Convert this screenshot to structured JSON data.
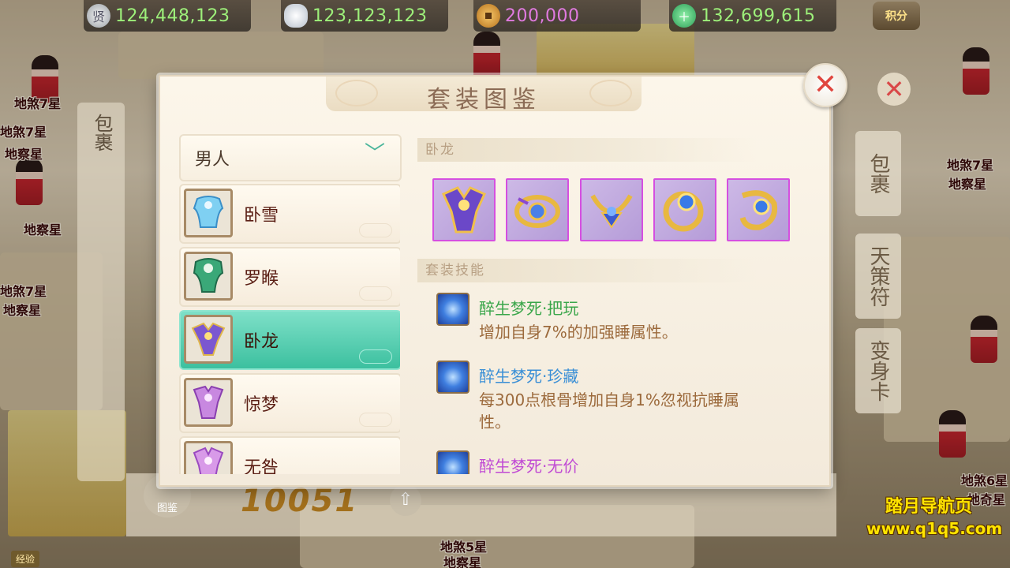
{
  "currency": [
    {
      "icon": "silver-coin-icon",
      "value": "124,448,123"
    },
    {
      "icon": "silver-ingot-icon",
      "value": "123,123,123"
    },
    {
      "icon": "copper-coin-icon",
      "value": "200,000"
    },
    {
      "icon": "jade-icon",
      "value": "132,699,615"
    }
  ],
  "points_button": "积分",
  "background": {
    "npc_names": [
      "地煞7星",
      "地察星",
      "地煞7星",
      "地察星",
      "地煞7星",
      "地察星",
      "地煞7星",
      "地察星",
      "地煞6星",
      "地奇星",
      "地煞5星",
      "地察星"
    ],
    "left_tab": "包裹",
    "right_tabs": [
      "包裹",
      "天策符",
      "变身卡"
    ],
    "score": "10051",
    "tujian_label": "图鉴",
    "exp_label": "经验"
  },
  "dialog": {
    "title": "套装图鉴",
    "gender_selected": "男人",
    "sets": [
      {
        "name": "卧雪",
        "active": false
      },
      {
        "name": "罗睺",
        "active": false
      },
      {
        "name": "卧龙",
        "active": true
      },
      {
        "name": "惊梦",
        "active": false
      },
      {
        "name": "无咎",
        "active": false
      }
    ],
    "current_set_header": "卧龙",
    "skills_header": "套装技能",
    "skills": [
      {
        "title": "醉生梦死·把玩",
        "desc": "增加自身7%的加强睡属性。",
        "color": "#3aa64a"
      },
      {
        "title": "醉生梦死·珍藏",
        "desc": "每300点根骨增加自身1%忽视抗睡属性。",
        "color": "#3a8fd6"
      },
      {
        "title": "醉生梦死·无价",
        "desc": "",
        "color": "#c04ad4"
      }
    ]
  },
  "watermark": {
    "line1": "踏月导航页",
    "line2": "www.q1q5.com"
  },
  "colors": {
    "accent_teal": "#3cc09f",
    "currency_text": "#9df07a",
    "equip_border": "#d54fe0",
    "close_red": "#e0463e"
  }
}
